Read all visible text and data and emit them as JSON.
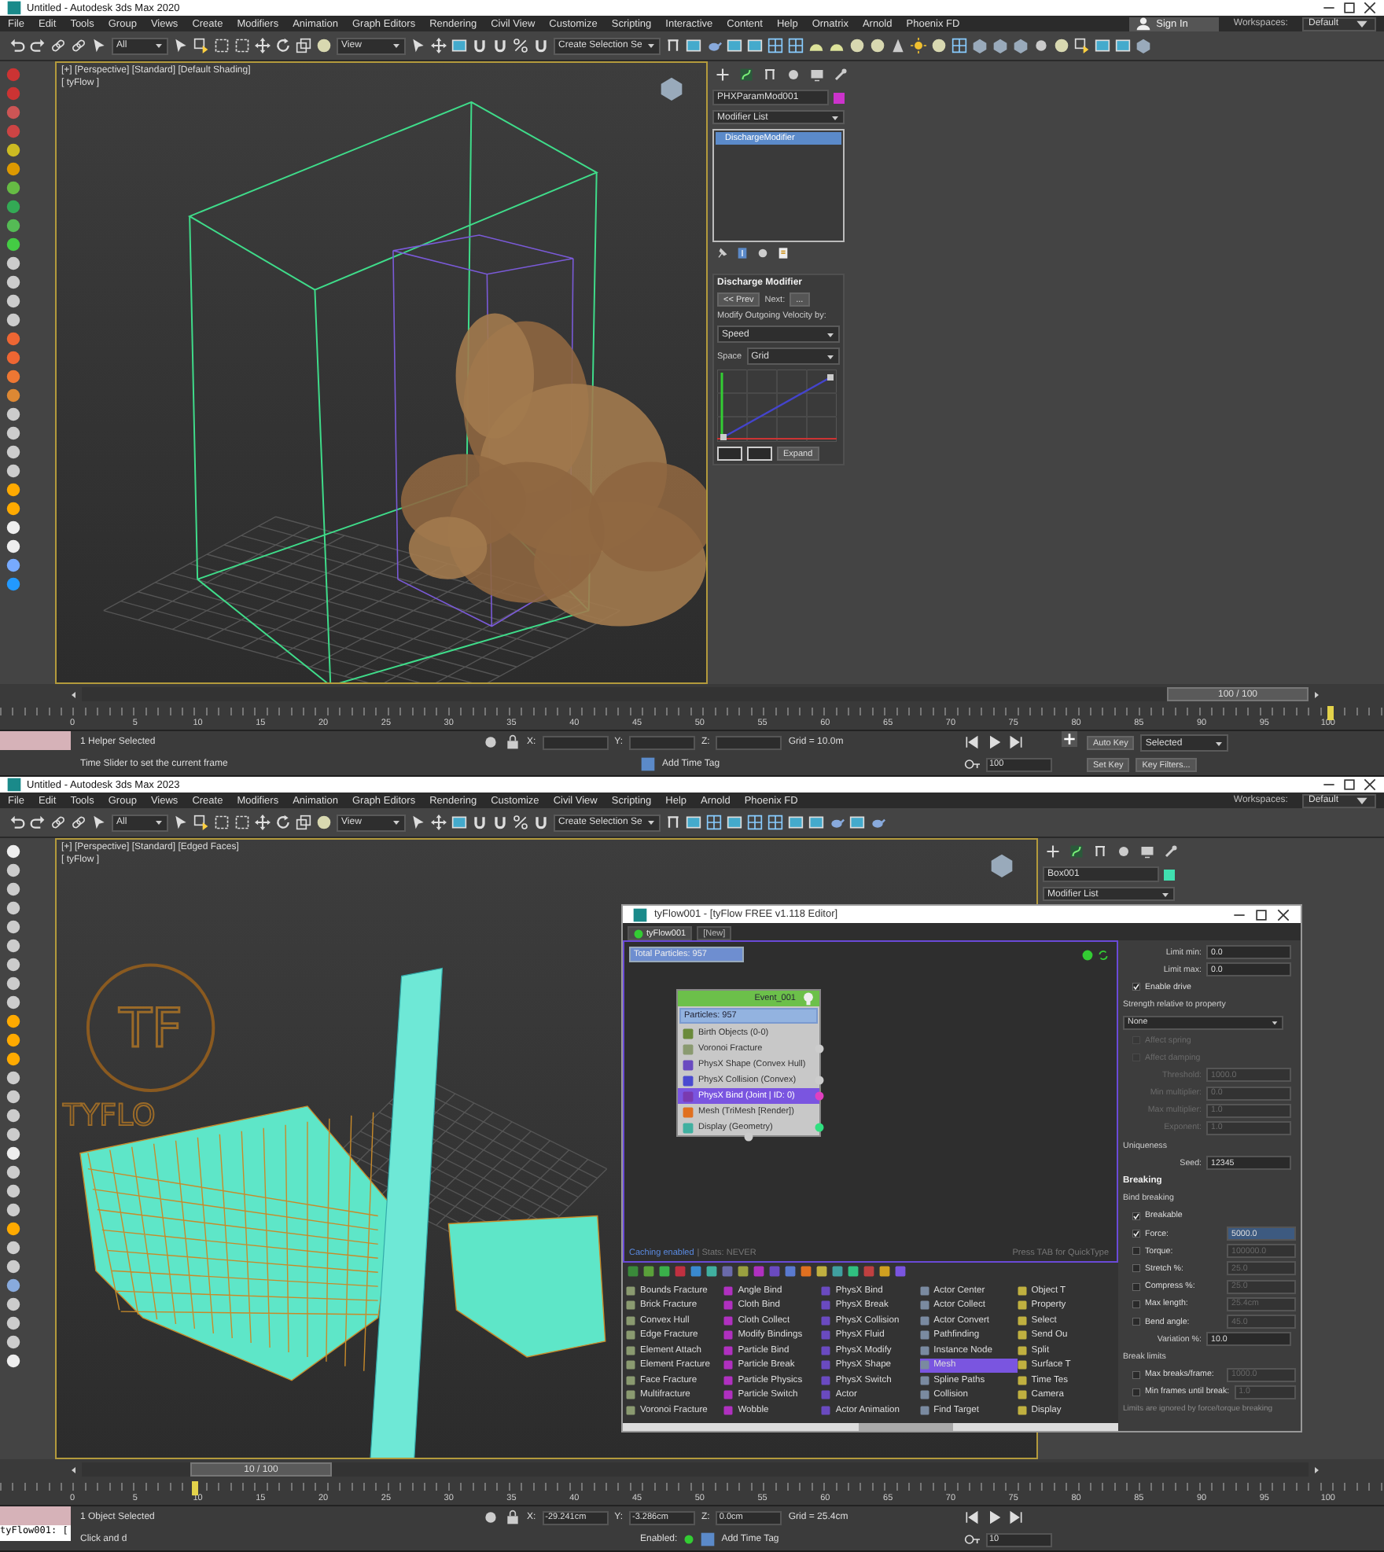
{
  "windows": [
    {
      "title": "Untitled - Autodesk 3ds Max 2020",
      "menu": [
        "File",
        "Edit",
        "Tools",
        "Group",
        "Views",
        "Create",
        "Modifiers",
        "Animation",
        "Graph Editors",
        "Rendering",
        "Civil View",
        "Customize",
        "Scripting",
        "Interactive",
        "Content",
        "Help",
        "Ornatrix",
        "Arnold",
        "Phoenix FD"
      ],
      "sign_in": "Sign In",
      "workspace_label": "Workspaces:",
      "workspace": "Default",
      "toolbar_fields": [
        "All",
        "View",
        "Create Selection Se"
      ],
      "viewport": {
        "kind": "smoke",
        "label": "[+] [Perspective] [Standard] [Default Shading]",
        "sublabel": "[ tyFlow ]"
      },
      "command_panel": {
        "object_name": "PHXParamMod001",
        "color": "#cc33cc",
        "modifier_list": "Modifier List",
        "stack": [
          {
            "label": "DischargeModifier",
            "selected": true
          }
        ],
        "rollout": {
          "title": "Discharge Modifier",
          "prev": "<< Prev",
          "next": "Next:",
          "more": "...",
          "caption": "Modify Outgoing Velocity by:",
          "mode": "Speed",
          "space_label": "Space",
          "space": "Grid",
          "expand": "Expand"
        }
      },
      "time_slider": {
        "reading": "100 / 100",
        "level": 1
      },
      "ruler": [
        "0",
        "5",
        "10",
        "15",
        "20",
        "25",
        "30",
        "35",
        "40",
        "45",
        "50",
        "55",
        "60",
        "65",
        "70",
        "75",
        "80",
        "85",
        "90",
        "95",
        "100"
      ],
      "status": {
        "selection": "1 Helper Selected",
        "prompt": "Time Slider to set the current frame",
        "coords": [
          {
            "label": "X:"
          },
          {
            "label": "Y:"
          },
          {
            "label": "Z:"
          }
        ],
        "grid": "Grid = 10.0m",
        "time_tag": "Add Time Tag",
        "frame": "100",
        "auto_key": "Auto Key",
        "key_mode": "Selected",
        "set_key": "Set Key",
        "key_filters": "Key Filters..."
      }
    },
    {
      "title": "Untitled - Autodesk 3ds Max 2023",
      "menu": [
        "File",
        "Edit",
        "Tools",
        "Group",
        "Views",
        "Create",
        "Modifiers",
        "Animation",
        "Graph Editors",
        "Rendering",
        "Customize",
        "Civil View",
        "Scripting",
        "Help",
        "Arnold",
        "Phoenix FD"
      ],
      "workspace_label": "Workspaces:",
      "workspace": "Default",
      "toolbar_fields": [
        "All",
        "View",
        "Create Selection Se"
      ],
      "viewport": {
        "kind": "fracture",
        "label": "[+] [Perspective] [Standard] [Edged Faces]",
        "sublabel": "[ tyFlow ]",
        "logo_mark": "TF",
        "logo_word": "TYFLO"
      },
      "command_panel": {
        "object_name": "Box001",
        "color": "#40e0b0",
        "modifier_list": "Modifier List"
      },
      "editor": {
        "title": "tyFlow001 - [tyFlow FREE v1.118 Editor]",
        "tabs": [
          {
            "label": "tyFlow001",
            "selected": true
          },
          {
            "label": "[New]",
            "selected": false
          }
        ],
        "total": "Total Particles: 957",
        "node": {
          "title": "Event_001",
          "count": "Particles: 957",
          "operators": [
            {
              "label": "Birth Objects (0-0)",
              "color": "#6a8a3a",
              "selected": false
            },
            {
              "label": "Voronoi Fracture",
              "color": "#8a9a70",
              "selected": false,
              "port": {
                "color": "#cccccc"
              }
            },
            {
              "label": "PhysX Shape (Convex Hull)",
              "color": "#6a4ac0",
              "selected": false
            },
            {
              "label": "PhysX Collision (Convex)",
              "color": "#4a4ad0",
              "selected": false,
              "port": {
                "color": "#cccccc"
              }
            },
            {
              "label": "PhysX Bind (Joint | ID: 0)",
              "color": "#7a3ab0",
              "selected": true,
              "port": {
                "color": "#e040c0"
              }
            },
            {
              "label": "Mesh (TriMesh [Render])",
              "color": "#e07020",
              "selected": false
            },
            {
              "label": "Display (Geometry)",
              "color": "#40b0a0",
              "selected": false,
              "port": {
                "color": "#30e080"
              }
            }
          ]
        },
        "caching": "Caching enabled",
        "stats": "| Stats: NEVER",
        "hint": "Press TAB for QuickType",
        "op_columns": [
          {
            "color": "#8a9a70",
            "items": [
              {
                "label": "Bounds Fracture",
                "selected": false
              },
              {
                "label": "Brick Fracture",
                "selected": false
              },
              {
                "label": "Convex Hull",
                "selected": false
              },
              {
                "label": "Edge Fracture",
                "selected": false
              },
              {
                "label": "Element Attach",
                "selected": false
              },
              {
                "label": "Element Fracture",
                "selected": false
              },
              {
                "label": "Face Fracture",
                "selected": false
              },
              {
                "label": "Multifracture",
                "selected": false
              },
              {
                "label": "Voronoi Fracture",
                "selected": false
              }
            ]
          },
          {
            "color": "#b030c0",
            "items": [
              {
                "label": "Angle Bind",
                "selected": false
              },
              {
                "label": "Cloth Bind",
                "selected": false
              },
              {
                "label": "Cloth Collect",
                "selected": false
              },
              {
                "label": "Modify Bindings",
                "selected": false
              },
              {
                "label": "Particle Bind",
                "selected": false
              },
              {
                "label": "Particle Break",
                "selected": false
              },
              {
                "label": "Particle Physics",
                "selected": false
              },
              {
                "label": "Particle Switch",
                "selected": false
              },
              {
                "label": "Wobble",
                "selected": false
              }
            ]
          },
          {
            "color": "#6a4ac0",
            "items": [
              {
                "label": "PhysX Bind",
                "selected": false
              },
              {
                "label": "PhysX Break",
                "selected": false
              },
              {
                "label": "PhysX Collision",
                "selected": false
              },
              {
                "label": "PhysX Fluid",
                "selected": false
              },
              {
                "label": "PhysX Modify",
                "selected": false
              },
              {
                "label": "PhysX Shape",
                "selected": false
              },
              {
                "label": "PhysX Switch",
                "selected": false
              },
              {
                "label": "Actor",
                "selected": false
              },
              {
                "label": "Actor Animation",
                "selected": false
              }
            ]
          },
          {
            "color": "#7a8aa0",
            "items": [
              {
                "label": "Actor Center",
                "selected": false
              },
              {
                "label": "Actor Collect",
                "selected": false
              },
              {
                "label": "Actor Convert",
                "selected": false
              },
              {
                "label": "Pathfinding",
                "selected": false
              },
              {
                "label": "Instance Node",
                "selected": false
              },
              {
                "label": "Mesh",
                "selected": true
              },
              {
                "label": "Spline Paths",
                "selected": false
              },
              {
                "label": "Collision",
                "selected": false
              },
              {
                "label": "Find Target",
                "selected": false
              }
            ]
          },
          {
            "color": "#c0b040",
            "items": [
              {
                "label": "Object T",
                "selected": false
              },
              {
                "label": "Property",
                "selected": false
              },
              {
                "label": "Select",
                "selected": false
              },
              {
                "label": "Send Ou",
                "selected": false
              },
              {
                "label": "Split",
                "selected": false
              },
              {
                "label": "Surface T",
                "selected": false
              },
              {
                "label": "Time Tes",
                "selected": false
              },
              {
                "label": "Camera",
                "selected": false
              },
              {
                "label": "Display",
                "selected": false
              }
            ]
          }
        ],
        "params": [
          {
            "kind": "field",
            "label": "Limit min:",
            "value": "0.0",
            "disabled": false
          },
          {
            "kind": "field",
            "label": "Limit max:",
            "value": "0.0",
            "disabled": false
          },
          {
            "kind": "check",
            "label": "Enable drive",
            "checked": true,
            "disabled": false
          },
          {
            "kind": "heading",
            "label": "Strength relative to property",
            "disabled": false
          },
          {
            "kind": "dropdown",
            "value": "None",
            "disabled": false
          },
          {
            "kind": "check",
            "label": "Affect spring",
            "checked": false,
            "disabled": true
          },
          {
            "kind": "check",
            "label": "Affect damping",
            "checked": false,
            "disabled": true
          },
          {
            "kind": "field",
            "label": "Threshold:",
            "value": "1000.0",
            "disabled": true
          },
          {
            "kind": "field",
            "label": "Min multiplier:",
            "value": "0.0",
            "disabled": true
          },
          {
            "kind": "field",
            "label": "Max multiplier:",
            "value": "1.0",
            "disabled": true
          },
          {
            "kind": "field",
            "label": "Exponent:",
            "value": "1.0",
            "disabled": true
          },
          {
            "kind": "heading",
            "label": "Uniqueness",
            "disabled": false
          },
          {
            "kind": "field",
            "label": "Seed:",
            "value": "12345",
            "disabled": false
          },
          {
            "kind": "rollout",
            "label": "Breaking",
            "disabled": false
          },
          {
            "kind": "heading",
            "label": "Bind breaking",
            "disabled": false
          },
          {
            "kind": "check",
            "label": "Breakable",
            "checked": true,
            "disabled": false
          },
          {
            "kind": "checkfield",
            "label": "Force:",
            "value": "5000.0",
            "checked": true,
            "disabled": false
          },
          {
            "kind": "checkfield",
            "label": "Torque:",
            "value": "100000.0",
            "checked": false,
            "disabled": false
          },
          {
            "kind": "checkfield",
            "label": "Stretch %:",
            "value": "25.0",
            "checked": false,
            "disabled": false
          },
          {
            "kind": "checkfield",
            "label": "Compress %:",
            "value": "25.0",
            "checked": false,
            "disabled": false
          },
          {
            "kind": "checkfield",
            "label": "Max length:",
            "value": "25.4cm",
            "checked": false,
            "disabled": false
          },
          {
            "kind": "checkfield",
            "label": "Bend angle:",
            "value": "45.0",
            "checked": false,
            "disabled": false
          },
          {
            "kind": "field",
            "label": "Variation %:",
            "value": "10.0",
            "disabled": false
          },
          {
            "kind": "heading",
            "label": "Break limits",
            "disabled": false
          },
          {
            "kind": "checkfield",
            "label": "Max breaks/frame:",
            "value": "1000.0",
            "checked": false,
            "disabled": false
          },
          {
            "kind": "checkfield",
            "label": "Min frames until break:",
            "value": "1.0",
            "checked": false,
            "disabled": false
          },
          {
            "kind": "note",
            "label": "Limits are ignored by force/torque breaking",
            "disabled": true
          }
        ]
      },
      "time_slider": {
        "reading": "10 / 100",
        "level": 0.1
      },
      "ruler": [
        "0",
        "5",
        "10",
        "15",
        "20",
        "25",
        "30",
        "35",
        "40",
        "45",
        "50",
        "55",
        "60",
        "65",
        "70",
        "75",
        "80",
        "85",
        "90",
        "95",
        "100"
      ],
      "status": {
        "listener": "tyFlow001: [",
        "selection": "1 Object Selected",
        "prompt": "Click and d",
        "coords": [
          {
            "label": "X:",
            "value": "-29.241cm"
          },
          {
            "label": "Y:",
            "value": "-3.286cm"
          },
          {
            "label": "Z:",
            "value": "0.0cm"
          }
        ],
        "grid": "Grid = 25.4cm",
        "enabled": "Enabled:",
        "time_tag": "Add Time Tag",
        "frame": "10"
      }
    }
  ]
}
